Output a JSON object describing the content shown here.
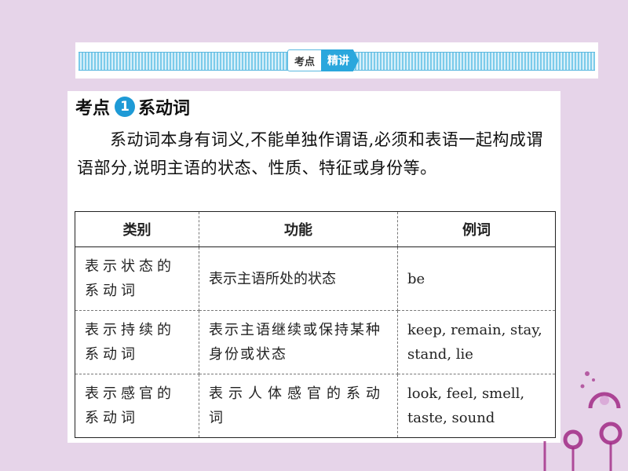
{
  "banner": {
    "tag_left": "考点",
    "tag_right": "精讲"
  },
  "section": {
    "prefix": "考点",
    "number": "1",
    "title": "系动词",
    "intro": "系动词本身有词义,不能单独作谓语,必须和表语一起构成谓语部分,说明主语的状态、性质、特征或身份等。"
  },
  "table": {
    "headers": [
      "类别",
      "功能",
      "例词"
    ],
    "rows": [
      [
        "表示状态的系动词",
        "表示主语所处的状态",
        "be"
      ],
      [
        "表示持续的系动词",
        "表示主语继续或保持某种身份或状态",
        "keep, remain, stay, stand, lie"
      ],
      [
        "表示感官的系动词",
        "表示人体感官的系动词",
        "look, feel, smell, taste, sound"
      ]
    ]
  },
  "colors": {
    "background": "#e6d4e9",
    "accent": "#1e9ad6",
    "decoration": "#a12a86"
  }
}
